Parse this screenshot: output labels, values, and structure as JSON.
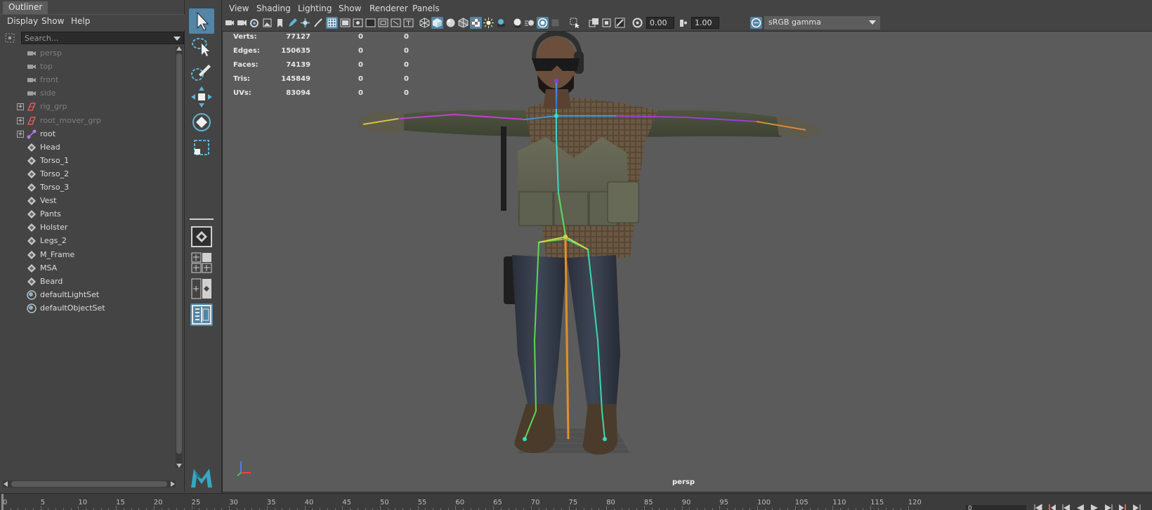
{
  "outliner": {
    "tab_label": "Outliner",
    "menus": [
      "Display",
      "Show",
      "Help"
    ],
    "search_placeholder": "Search...",
    "items": [
      {
        "label": "persp",
        "icon": "camera-icon",
        "state": "dim",
        "expandable": false
      },
      {
        "label": "top",
        "icon": "camera-icon",
        "state": "dim",
        "expandable": false
      },
      {
        "label": "front",
        "icon": "camera-icon",
        "state": "dim",
        "expandable": false
      },
      {
        "label": "side",
        "icon": "camera-icon",
        "state": "dim",
        "expandable": false
      },
      {
        "label": "rig_grp",
        "icon": "group-icon",
        "state": "dim",
        "expandable": true
      },
      {
        "label": "root_mover_grp",
        "icon": "group-icon",
        "state": "dim",
        "expandable": true
      },
      {
        "label": "root",
        "icon": "joint-icon",
        "state": "bright",
        "expandable": true
      },
      {
        "label": "Head",
        "icon": "mesh-icon",
        "state": "bright",
        "expandable": false
      },
      {
        "label": "Torso_1",
        "icon": "mesh-icon",
        "state": "bright",
        "expandable": false
      },
      {
        "label": "Torso_2",
        "icon": "mesh-icon",
        "state": "bright",
        "expandable": false
      },
      {
        "label": "Torso_3",
        "icon": "mesh-icon",
        "state": "bright",
        "expandable": false
      },
      {
        "label": "Vest",
        "icon": "mesh-icon",
        "state": "bright",
        "expandable": false
      },
      {
        "label": "Pants",
        "icon": "mesh-icon",
        "state": "bright",
        "expandable": false
      },
      {
        "label": "Holster",
        "icon": "mesh-icon",
        "state": "bright",
        "expandable": false
      },
      {
        "label": "Legs_2",
        "icon": "mesh-icon",
        "state": "bright",
        "expandable": false
      },
      {
        "label": "M_Frame",
        "icon": "mesh-icon",
        "state": "bright",
        "expandable": false
      },
      {
        "label": "MSA",
        "icon": "mesh-icon",
        "state": "bright",
        "expandable": false
      },
      {
        "label": "Beard",
        "icon": "mesh-icon",
        "state": "bright",
        "expandable": false
      },
      {
        "label": "defaultLightSet",
        "icon": "set-icon",
        "state": "bright",
        "expandable": false
      },
      {
        "label": "defaultObjectSet",
        "icon": "set-icon",
        "state": "bright",
        "expandable": false
      }
    ]
  },
  "toolbox": {
    "tools": [
      "select-tool-icon",
      "lasso-tool-icon",
      "paint-select-tool-icon",
      "move-tool-icon",
      "rotate-tool-icon",
      "scale-tool-icon"
    ],
    "layouts": [
      "single-perspective-layout-icon",
      "four-view-layout-icon",
      "two-view-layout-icon",
      "outliner-persp-layout-icon"
    ]
  },
  "viewport": {
    "menus": [
      "View",
      "Shading",
      "Lighting",
      "Show",
      "Renderer",
      "Panels"
    ],
    "exposure_value": "0.00",
    "gamma_value": "1.00",
    "colorspace": "sRGB gamma",
    "camera_label": "persp",
    "hud": [
      {
        "label": "Verts:",
        "v1": "77127",
        "v2": "0",
        "v3": "0"
      },
      {
        "label": "Edges:",
        "v1": "150635",
        "v2": "0",
        "v3": "0"
      },
      {
        "label": "Faces:",
        "v1": "74139",
        "v2": "0",
        "v3": "0"
      },
      {
        "label": "Tris:",
        "v1": "145849",
        "v2": "0",
        "v3": "0"
      },
      {
        "label": "UVs:",
        "v1": "83094",
        "v2": "0",
        "v3": "0"
      }
    ]
  },
  "timeslider": {
    "ticks": [
      "0",
      "5",
      "10",
      "15",
      "20",
      "25",
      "30",
      "35",
      "40",
      "45",
      "50",
      "55",
      "60",
      "65",
      "70",
      "75",
      "80",
      "85",
      "90",
      "95",
      "100",
      "105",
      "110",
      "115",
      "120"
    ],
    "current_frame": "0"
  },
  "colors": {
    "panel_bg": "#444444",
    "viewport_bg": "#5b5b5b",
    "accent": "#5285a6"
  }
}
